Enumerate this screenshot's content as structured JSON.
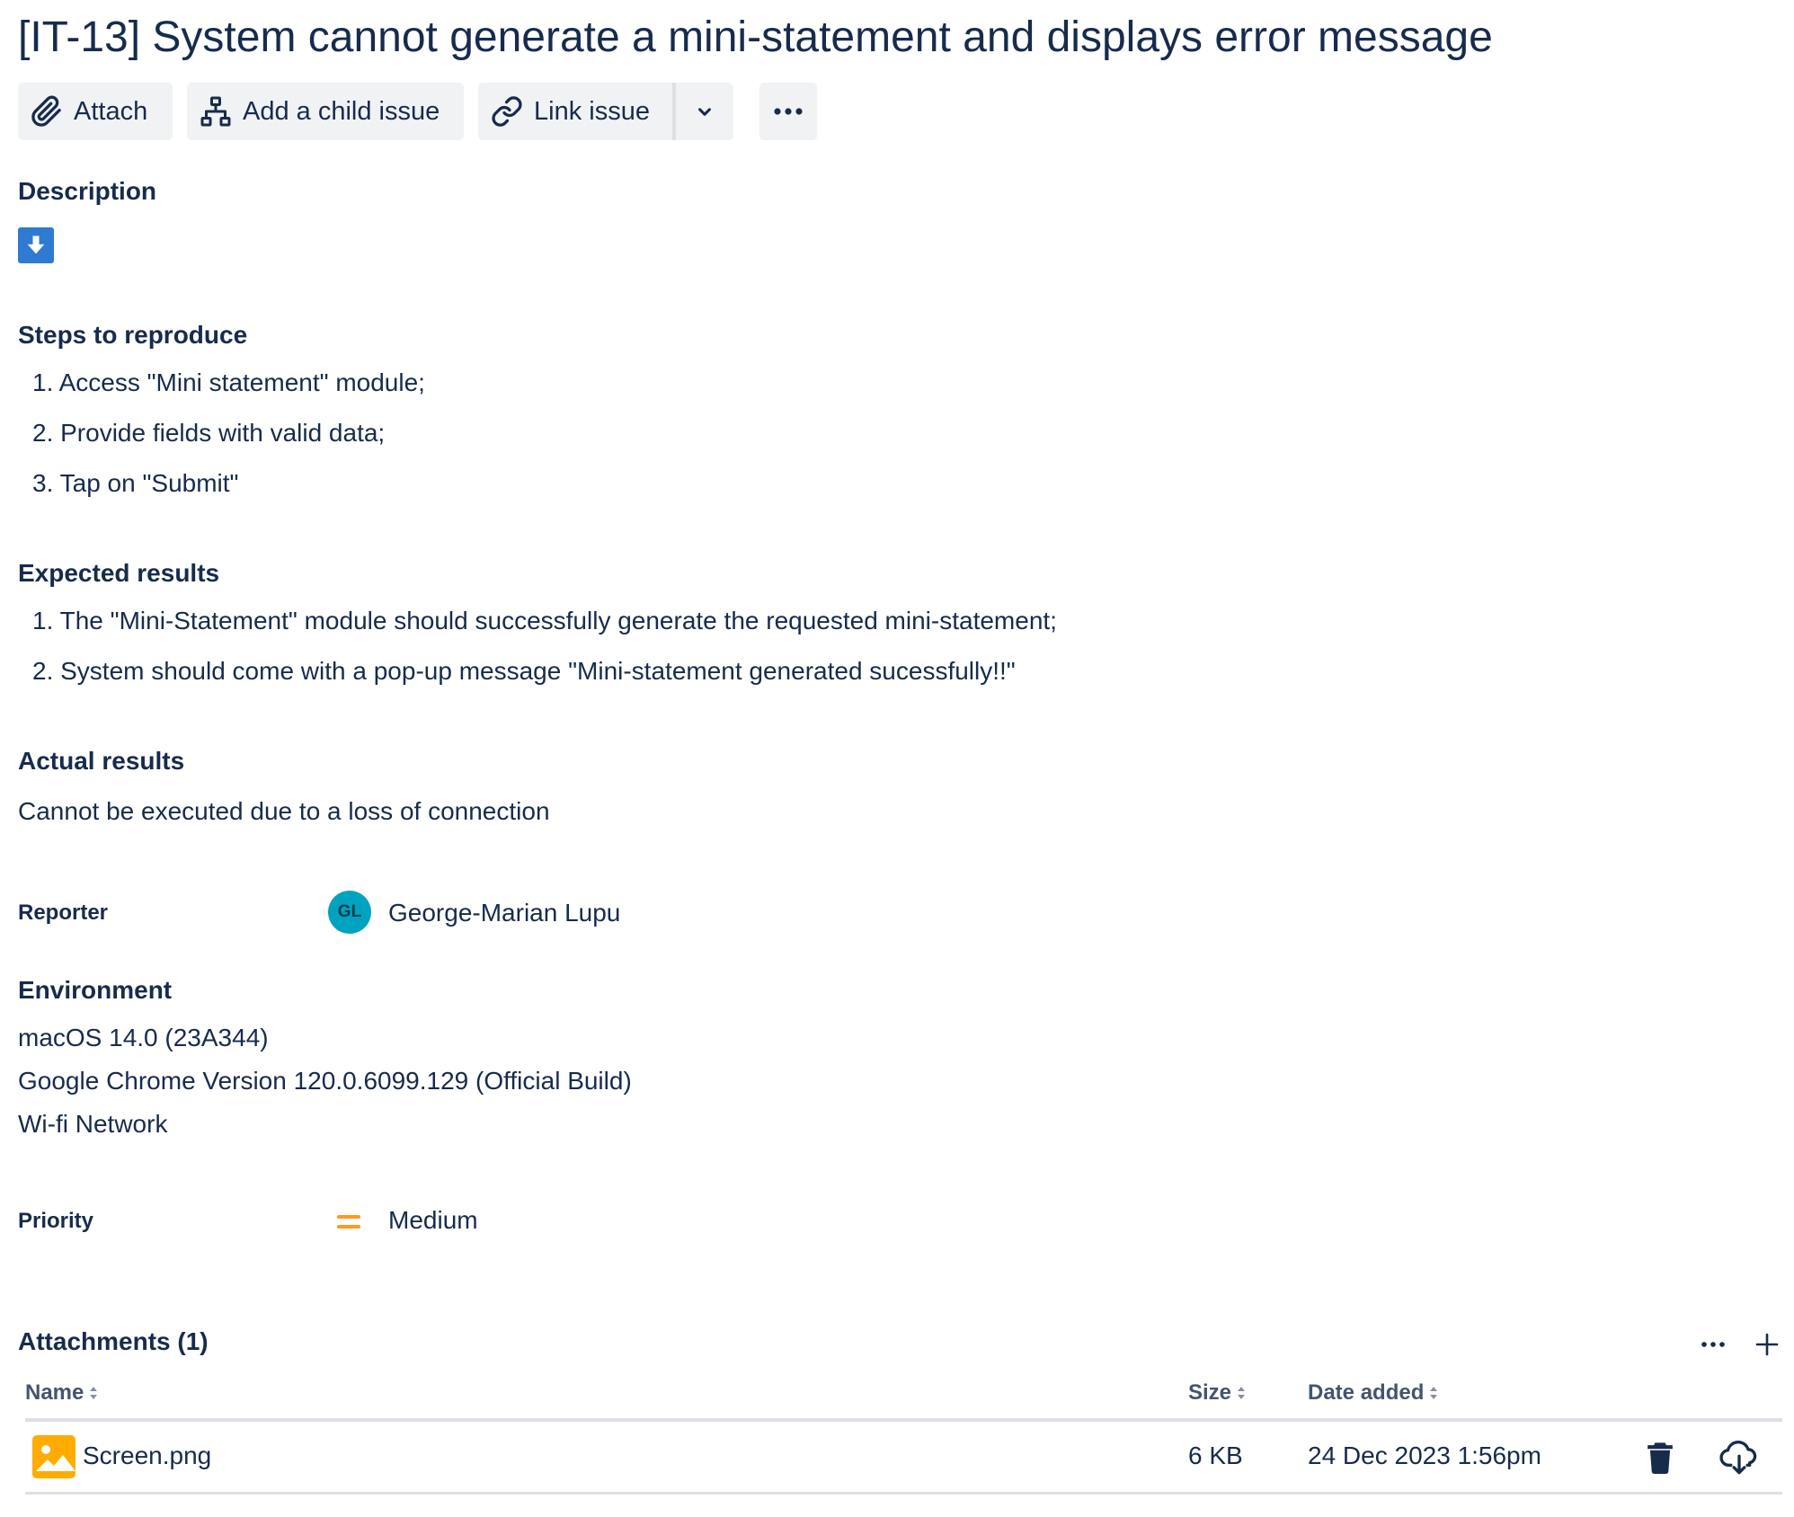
{
  "issue": {
    "title": "[IT-13] System cannot generate a mini-statement and displays error message"
  },
  "toolbar": {
    "attach_label": "Attach",
    "child_issue_label": "Add a child issue",
    "link_issue_label": "Link issue"
  },
  "description": {
    "heading": "Description",
    "steps_heading": "Steps to reproduce",
    "steps": [
      "1. Access \"Mini statement\" module;",
      "2. Provide fields with valid data;",
      "3. Tap on \"Submit\""
    ],
    "expected_heading": "Expected results",
    "expected": [
      "1. The \"Mini-Statement\" module should successfully generate the requested mini-statement;",
      "2. System should come with a pop-up message \"Mini-statement generated sucessfully!!\""
    ],
    "actual_heading": "Actual results",
    "actual_text": "Cannot be executed due to a loss of connection"
  },
  "reporter": {
    "label": "Reporter",
    "initials": "GL",
    "name": "George-Marian Lupu",
    "avatar_color": "#00a3bf"
  },
  "environment": {
    "heading": "Environment",
    "lines": [
      "macOS 14.0 (23A344)",
      "Google Chrome Version 120.0.6099.129 (Official Build)",
      "Wi-fi Network"
    ]
  },
  "priority": {
    "label": "Priority",
    "value": "Medium",
    "icon": "priority-medium-icon",
    "color": "#ff991f"
  },
  "attachments": {
    "heading": "Attachments (1)",
    "columns": {
      "name": "Name",
      "size": "Size",
      "date": "Date added"
    },
    "rows": [
      {
        "name": "Screen.png",
        "size": "6 KB",
        "date": "24 Dec 2023 1:56pm",
        "icon": "image-file-icon",
        "icon_color": "#ffab00"
      }
    ]
  },
  "colors": {
    "text": "#172b4d",
    "button_bg": "#f1f2f4",
    "accent_blue": "#2f7bd1"
  }
}
